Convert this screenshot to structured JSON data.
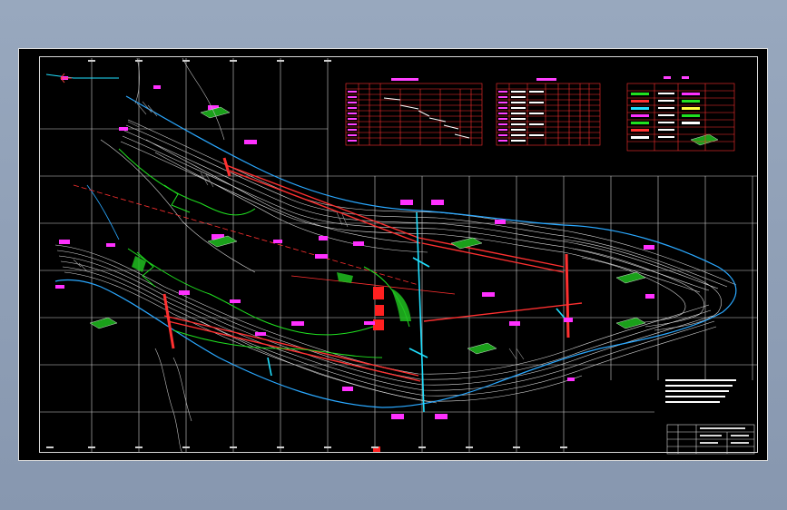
{
  "canvas": {
    "background": "#000000",
    "frame_color": "#d8d8d8",
    "grid_color": "#d0d0d0"
  },
  "colors": {
    "contour": "#d8d8d8",
    "boundary": "#2aa8ff",
    "road": "#ff3030",
    "annotation": "#ff40ff",
    "vegetation": "#20e020",
    "cyan_structure": "#20e0ff",
    "table_border": "#ff3030"
  },
  "tables": [
    {
      "id": "table-1",
      "rows": 12,
      "cols": 9
    },
    {
      "id": "table-2",
      "rows": 12,
      "cols": 9
    },
    {
      "id": "table-3",
      "rows": 10,
      "cols": 5
    }
  ],
  "icons": {
    "north_arrow": "north-arrow-icon"
  }
}
